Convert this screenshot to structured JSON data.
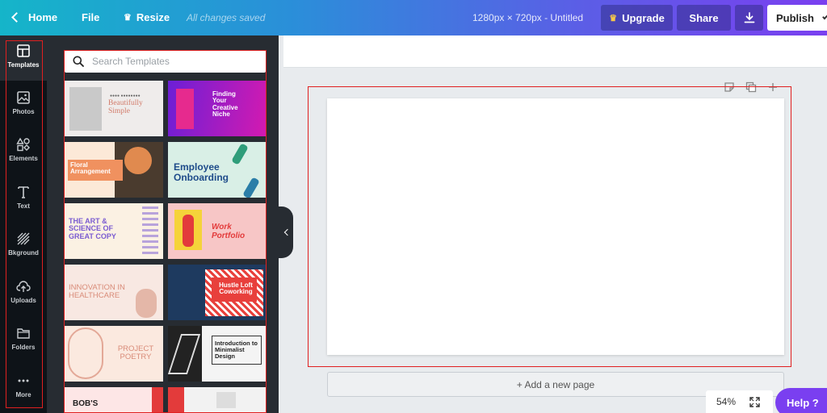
{
  "topbar": {
    "home_label": "Home",
    "file_label": "File",
    "resize_label": "Resize",
    "save_status": "All changes saved",
    "doc_info": "1280px × 720px - Untitled",
    "upgrade_label": "Upgrade",
    "share_label": "Share",
    "publish_label": "Publish"
  },
  "sidenav": {
    "items": [
      {
        "label": "Templates",
        "icon": "templates-icon"
      },
      {
        "label": "Photos",
        "icon": "photos-icon"
      },
      {
        "label": "Elements",
        "icon": "elements-icon"
      },
      {
        "label": "Text",
        "icon": "text-icon"
      },
      {
        "label": "Bkground",
        "icon": "background-icon"
      },
      {
        "label": "Uploads",
        "icon": "uploads-icon"
      },
      {
        "label": "Folders",
        "icon": "folders-icon"
      },
      {
        "label": "More",
        "icon": "more-icon"
      }
    ]
  },
  "templates": {
    "search_placeholder": "Search Templates",
    "items": [
      {
        "title": "Beautifully Simple"
      },
      {
        "title": "Finding Your Creative Niche"
      },
      {
        "title": "Floral Arrangement"
      },
      {
        "title": "Employee Onboarding"
      },
      {
        "title": "THE ART & SCIENCE OF GREAT COPY"
      },
      {
        "title": "Work Portfolio"
      },
      {
        "title": "INNOVATION IN HEALTHCARE"
      },
      {
        "title": "Hustle Loft Coworking"
      },
      {
        "title": "PROJECT POETRY"
      },
      {
        "title": "Introduction to Minimalist Design"
      },
      {
        "title": "BOB'S"
      },
      {
        "title": ""
      }
    ]
  },
  "canvas": {
    "add_page_label": "+ Add a new page",
    "zoom": "54%"
  },
  "help_label": "Help ?",
  "colors": {
    "accent": "#7a3ff0",
    "highlight": "#e02020"
  }
}
